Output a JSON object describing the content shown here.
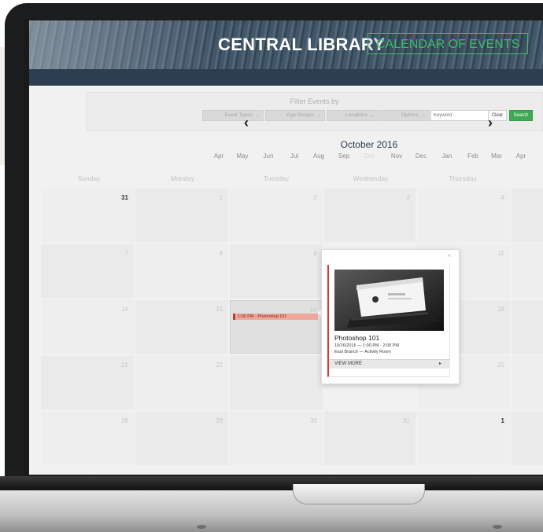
{
  "header": {
    "title": "CENTRAL LIBRARY",
    "subtitle": "CALENDAR OF EVENTS"
  },
  "filter": {
    "heading": "Filter Events by",
    "selects": [
      "Event Types",
      "Age Groups",
      "Locations",
      "Options"
    ],
    "keyword_placeholder": "Keyword",
    "clear_label": "Clear",
    "search_label": "Search"
  },
  "calendar": {
    "month_title": "October 2016",
    "month_strip": [
      "Apr",
      "May",
      "Jun",
      "Jul",
      "Aug",
      "Sep",
      "Oct",
      "Nov",
      "Dec",
      "Jan",
      "Feb",
      "Mar",
      "Apr"
    ],
    "current_month": "Oct",
    "weekdays": [
      "Sunday",
      "Monday",
      "Tuesday",
      "Wednesday",
      "Thursday"
    ],
    "weeks": [
      [
        "31",
        "1",
        "2",
        "3",
        "4"
      ],
      [
        "7",
        "8",
        "9",
        "",
        "11"
      ],
      [
        "14",
        "15",
        "16",
        "",
        "18"
      ],
      [
        "21",
        "22",
        "",
        "",
        "25"
      ],
      [
        "28",
        "29",
        "30",
        "31",
        "1"
      ]
    ],
    "event_chip": "1:00 PM - Photoshop 101"
  },
  "popover": {
    "close": "×",
    "event_title": "Photoshop 101",
    "date_time": "10/16/2016 — 1:00 PM - 2:00 PM",
    "location": "East Branch — Activity Room",
    "view_more": "VIEW MORE",
    "arrow": "▸"
  },
  "icons": {
    "prev": "‹",
    "next": "›"
  },
  "colors": {
    "brand_green": "#3fbb6a",
    "search_button": "#3fa852",
    "event_chip": "#f0a79b",
    "event_accent": "#d93a2e",
    "header_bg": "#3a4f63"
  }
}
